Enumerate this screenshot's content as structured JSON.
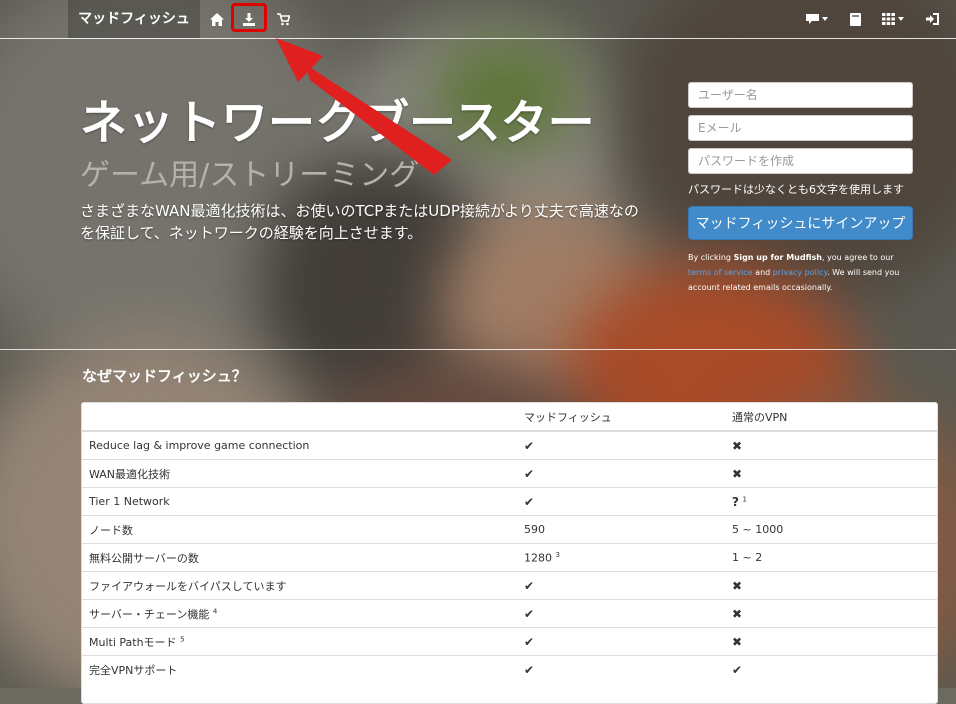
{
  "nav": {
    "brand": "マッドフィッシュ",
    "icons": [
      "home-icon",
      "download-icon",
      "cart-icon",
      "chat-icon",
      "book-icon",
      "grid-icon",
      "sign-in-icon"
    ]
  },
  "hero": {
    "title": "ネットワークブースター",
    "subtitle": "ゲーム用/ストリーミング",
    "description": "さまざまなWAN最適化技術は、お使いのTCPまたはUDP接続がより丈夫で高速なのを保証して、ネットワークの経験を向上させます。"
  },
  "signup": {
    "username_placeholder": "ユーザー名",
    "email_placeholder": "Eメール",
    "password_placeholder": "パスワードを作成",
    "password_hint": "パスワードは少なくとも6文字を使用します",
    "button_label": "マッドフィッシュにサインアップ",
    "legal_prefix": "By clicking ",
    "legal_bold": "Sign up for Mudfish",
    "legal_mid": ", you agree to our ",
    "terms_link": "terms of service",
    "legal_and": " and ",
    "privacy_link": "privacy policy",
    "legal_suffix": ". We will send you account related emails occasionally."
  },
  "comparison": {
    "title": "なぜマッドフィッシュ？",
    "headers": [
      "",
      "マッドフィッシュ",
      "通常のVPN"
    ],
    "rows": [
      {
        "feature": "Reduce lag & improve game connection",
        "feature_sup": "",
        "mudfish": "✔",
        "mudfish_sup": "",
        "vpn": "✖",
        "vpn_sup": ""
      },
      {
        "feature": "WAN最適化技術",
        "feature_sup": "",
        "mudfish": "✔",
        "mudfish_sup": "",
        "vpn": "✖",
        "vpn_sup": ""
      },
      {
        "feature": "Tier 1 Network",
        "feature_sup": "",
        "mudfish": "✔",
        "mudfish_sup": "",
        "vpn": "?",
        "vpn_sup": "1"
      },
      {
        "feature": "ノード数",
        "feature_sup": "",
        "mudfish": "590",
        "mudfish_sup": "",
        "vpn": "5 ~ 1000",
        "vpn_sup": ""
      },
      {
        "feature": "無料公開サーバーの数",
        "feature_sup": "",
        "mudfish": "1280",
        "mudfish_sup": "3",
        "vpn": "1 ~ 2",
        "vpn_sup": ""
      },
      {
        "feature": "ファイアウォールをバイパスしています",
        "feature_sup": "",
        "mudfish": "✔",
        "mudfish_sup": "",
        "vpn": "✖",
        "vpn_sup": ""
      },
      {
        "feature": "サーバー・チェーン機能",
        "feature_sup": "4",
        "mudfish": "✔",
        "mudfish_sup": "",
        "vpn": "✖",
        "vpn_sup": ""
      },
      {
        "feature": "Multi Pathモード",
        "feature_sup": "5",
        "mudfish": "✔",
        "mudfish_sup": "",
        "vpn": "✖",
        "vpn_sup": ""
      },
      {
        "feature": "完全VPNサポート",
        "feature_sup": "",
        "mudfish": "✔",
        "mudfish_sup": "",
        "vpn": "✔",
        "vpn_sup": ""
      }
    ]
  },
  "colors": {
    "primary_button": "#428bca",
    "highlight": "#e00000",
    "link": "#5aa3e6"
  }
}
